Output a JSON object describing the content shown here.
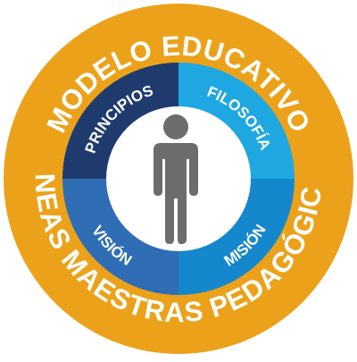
{
  "outer_ring": {
    "top_text": "MODELO EDUCATIVO",
    "bottom_text": "LÍNEAS MAESTRAS PEDAGÓGICAS"
  },
  "quadrants": [
    {
      "key": "principios",
      "label": "PRINCIPIOS"
    },
    {
      "key": "filosofia",
      "label": "FILOSOFÍA"
    },
    {
      "key": "mision",
      "label": "MISIÓN"
    },
    {
      "key": "vision",
      "label": "VISIÓN"
    }
  ],
  "center": {
    "icon": "person-icon"
  },
  "colors": {
    "ring": "#eba21a",
    "ring_edge": "#ffffff",
    "text": "#ffffff",
    "principios": "#1f3b6e",
    "filosofia": "#1ea7e1",
    "mision": "#1587cc",
    "vision": "#2f6db5",
    "center_fill": "#ffffff",
    "person": "#6c6c6c"
  }
}
